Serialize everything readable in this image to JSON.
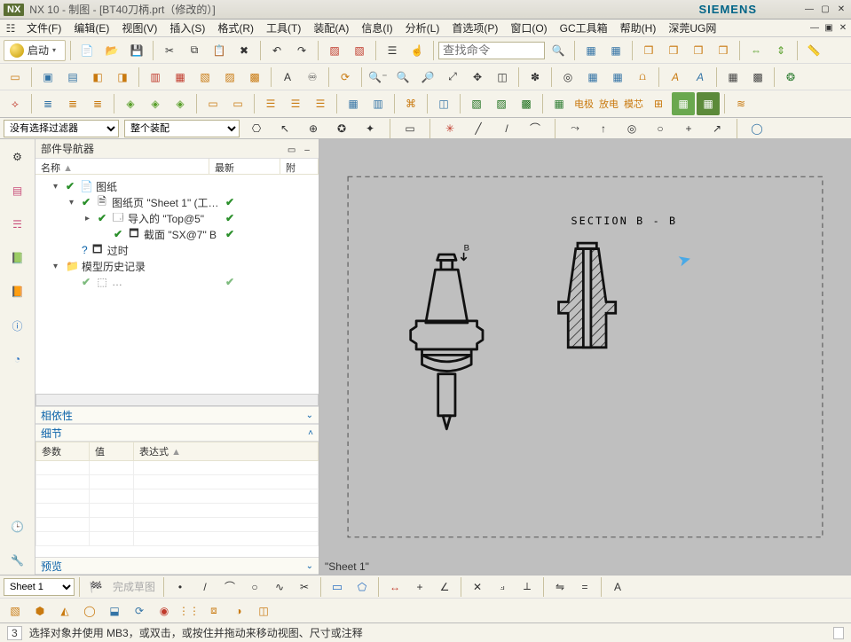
{
  "title": "NX 10 - 制图 - [BT40刀柄.prt（修改的）]",
  "brand": "SIEMENS",
  "menus": [
    "文件(F)",
    "编辑(E)",
    "视图(V)",
    "插入(S)",
    "格式(R)",
    "工具(T)",
    "装配(A)",
    "信息(I)",
    "分析(L)",
    "首选项(P)",
    "窗口(O)",
    "GC工具箱",
    "帮助(H)",
    "深莞UG网"
  ],
  "start_label": "启动",
  "search_placeholder": "查找命令",
  "filters": {
    "sel": "没有选择过滤器",
    "asm": "整个装配"
  },
  "nav": {
    "title": "部件导航器",
    "cols": {
      "name": "名称",
      "latest": "最新",
      "extra": "附"
    },
    "drawing": "图纸",
    "sheet": "图纸页 \"Sheet 1\" (工…",
    "top": "导入的 \"Top@5\"",
    "section_view": "截面 \"SX@7\" B",
    "outdated": "过时",
    "history": "模型历史记录",
    "deps": "相依性",
    "detail": "细节",
    "preview": "预览",
    "detail_cols": {
      "param": "参数",
      "value": "值",
      "expr": "表达式"
    }
  },
  "canvas": {
    "section_label": "SECTION  B - B",
    "cut_marker": "B",
    "sheet": "\"Sheet 1\""
  },
  "sheet_sel": "Sheet 1",
  "sketch_disabled": "完成草图",
  "status": {
    "num": "3",
    "msg": "选择对象并使用 MB3，或双击，或按住并拖动来移动视图、尺寸或注释"
  }
}
